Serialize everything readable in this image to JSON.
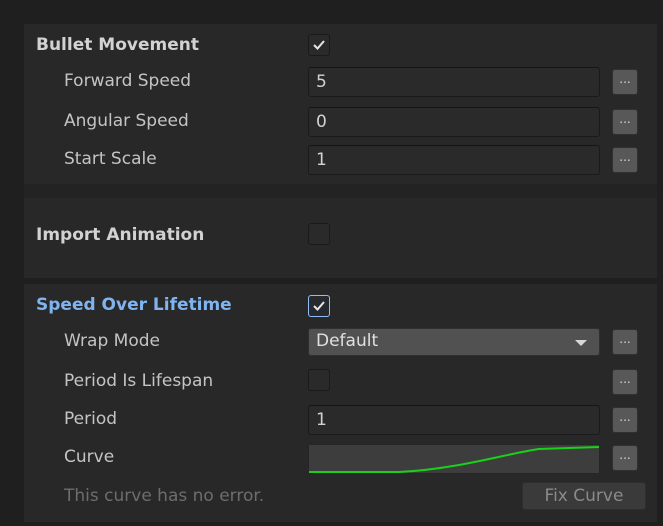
{
  "bullet_movement": {
    "header": "Bullet Movement",
    "enabled": true,
    "fields": [
      {
        "label": "Forward Speed",
        "value": "5",
        "more": "..."
      },
      {
        "label": "Angular Speed",
        "value": "0",
        "more": "..."
      },
      {
        "label": "Start Scale",
        "value": "1",
        "more": "..."
      }
    ]
  },
  "import_animation": {
    "header": "Import Animation",
    "enabled": false
  },
  "speed_over_lifetime": {
    "header": "Speed Over Lifetime",
    "enabled": true,
    "wrap_mode": {
      "label": "Wrap Mode",
      "value": "Default",
      "more": "..."
    },
    "period_is_lifespan": {
      "label": "Period Is Lifespan",
      "checked": false,
      "more": "..."
    },
    "period": {
      "label": "Period",
      "value": "1",
      "more": "..."
    },
    "curve": {
      "label": "Curve",
      "more": "...",
      "line_color": "#19d119"
    },
    "status": "This curve has no error.",
    "fix_button": "Fix Curve"
  },
  "colors": {
    "active_header": "#7fb4f0",
    "curve_line": "#19d119"
  }
}
